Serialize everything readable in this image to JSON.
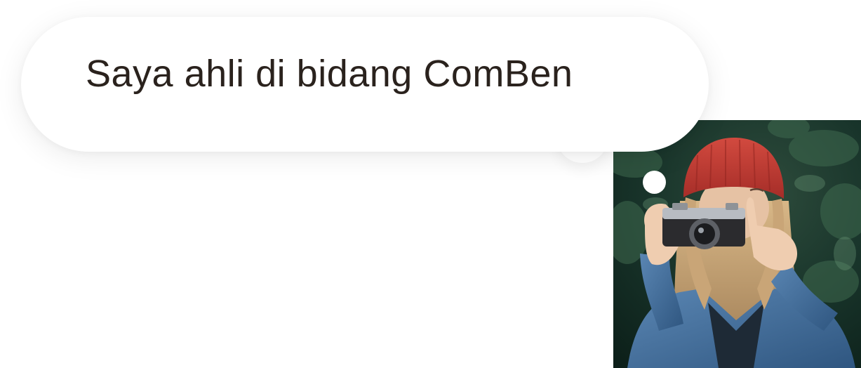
{
  "speech_bubble": {
    "text": "Saya ahli di bidang ComBen"
  },
  "photo": {
    "subject": "woman-with-camera-photo"
  },
  "colors": {
    "text": "#2a221d",
    "bubble": "#ffffff",
    "foliage": "#0f2a22",
    "beanie": "#c23a33",
    "jacket": "#3f6a98"
  }
}
